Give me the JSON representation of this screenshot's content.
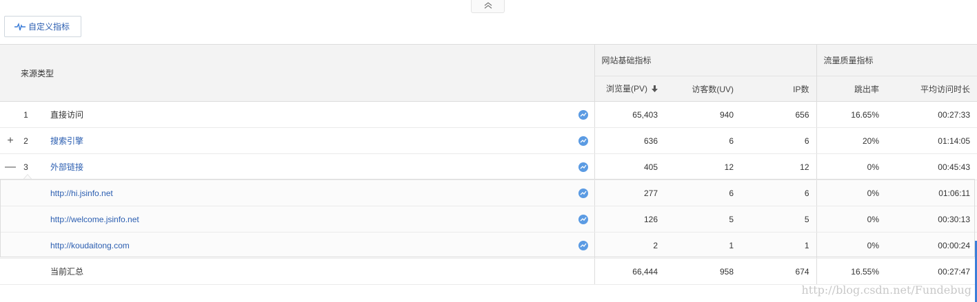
{
  "custom_metrics_label": "自定义指标",
  "header": {
    "source_type": "来源类型",
    "group_basic": "网站基础指标",
    "group_quality": "流量质量指标",
    "columns": [
      "浏览量(PV)",
      "访客数(UV)",
      "IP数",
      "跳出率",
      "平均访问时长"
    ],
    "sorted_column": "浏览量(PV)"
  },
  "rows": [
    {
      "toggle": "",
      "num": "1",
      "name": "直接访问",
      "link": false,
      "pv": "65,403",
      "uv": "940",
      "ip": "656",
      "bounce": "16.65%",
      "duration": "00:27:33"
    },
    {
      "toggle": "+",
      "num": "2",
      "name": "搜索引擎",
      "link": true,
      "pv": "636",
      "uv": "6",
      "ip": "6",
      "bounce": "20%",
      "duration": "01:14:05"
    },
    {
      "toggle": "—",
      "num": "3",
      "name": "外部链接",
      "link": true,
      "pv": "405",
      "uv": "12",
      "ip": "12",
      "bounce": "0%",
      "duration": "00:45:43"
    }
  ],
  "subrows": [
    {
      "name": "http://hi.jsinfo.net",
      "pv": "277",
      "uv": "6",
      "ip": "6",
      "bounce": "0%",
      "duration": "01:06:11"
    },
    {
      "name": "http://welcome.jsinfo.net",
      "pv": "126",
      "uv": "5",
      "ip": "5",
      "bounce": "0%",
      "duration": "00:30:13"
    },
    {
      "name": "http://koudaitong.com",
      "pv": "2",
      "uv": "1",
      "ip": "1",
      "bounce": "0%",
      "duration": "00:00:24"
    }
  ],
  "total": {
    "label": "当前汇总",
    "pv": "66,444",
    "uv": "958",
    "ip": "674",
    "bounce": "16.55%",
    "duration": "00:27:47"
  },
  "watermark": "http://blog.csdn.net/Fundebug",
  "colors": {
    "link": "#2a5db0",
    "trend_icon": "#5b9be3",
    "header_bg": "#f3f3f3"
  },
  "icons": {
    "collapse": "double-chevron-up-icon",
    "custom": "pulse-icon",
    "trend": "trend-chart-icon",
    "sort": "arrow-down-icon"
  }
}
